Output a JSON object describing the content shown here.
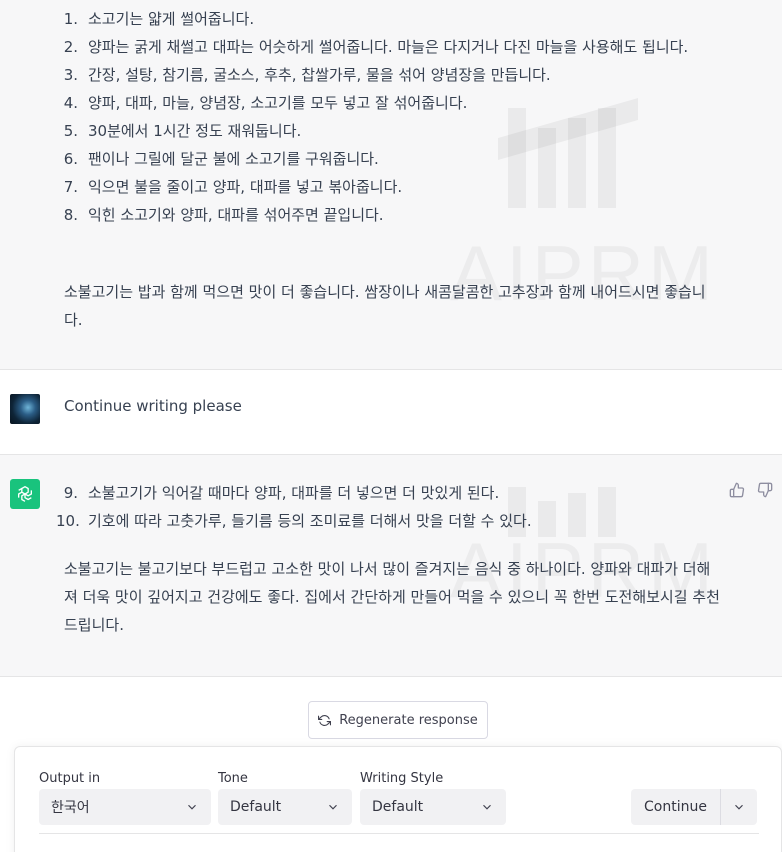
{
  "watermark": {
    "text": "AIPRM"
  },
  "response_1": {
    "steps": [
      {
        "num": "1.",
        "text": "소고기는 얇게 썰어줍니다."
      },
      {
        "num": "2.",
        "text": "양파는 굵게 채썰고 대파는 어슷하게 썰어줍니다. 마늘은 다지거나 다진 마늘을 사용해도 됩니다."
      },
      {
        "num": "3.",
        "text": "간장, 설탕, 참기름, 굴소스, 후추, 찹쌀가루, 물을 섞어 양념장을 만듭니다."
      },
      {
        "num": "4.",
        "text": "양파, 대파, 마늘, 양념장, 소고기를 모두 넣고 잘 섞어줍니다."
      },
      {
        "num": "5.",
        "text": "30분에서 1시간 정도 재워둡니다."
      },
      {
        "num": "6.",
        "text": "팬이나 그릴에 달군 불에 소고기를 구워줍니다."
      },
      {
        "num": "7.",
        "text": "익으면 불을 줄이고 양파, 대파를 넣고 볶아줍니다."
      },
      {
        "num": "8.",
        "text": "익힌 소고기와 양파, 대파를 섞어주면 끝입니다."
      }
    ],
    "closing": "소불고기는 밥과 함께 먹으면 맛이 더 좋습니다. 쌈장이나 새콤달콤한 고추장과 함께 내어드시면 좋습니다."
  },
  "user_message": {
    "text": "Continue writing please"
  },
  "response_2": {
    "steps": [
      {
        "num": "9.",
        "text": "소불고기가 익어갈 때마다 양파, 대파를 더 넣으면 더 맛있게 된다."
      },
      {
        "num": "10.",
        "text": "기호에 따라 고춧가루, 들기름 등의 조미료를 더해서 맛을 더할 수 있다."
      }
    ],
    "closing": "소불고기는 불고기보다 부드럽고 고소한 맛이 나서 많이 즐겨지는 음식 중 하나이다. 양파와 대파가 더해져 더욱 맛이 깊어지고 건강에도 좋다. 집에서 간단하게 만들어 먹을 수 있으니 꼭 한번 도전해보시길 추천드립니다."
  },
  "regenerate": {
    "label": "Regenerate response",
    "icon": "refresh-icon"
  },
  "prompt_panel": {
    "output": {
      "label": "Output in",
      "value": "한국어"
    },
    "tone": {
      "label": "Tone",
      "value": "Default"
    },
    "style": {
      "label": "Writing Style",
      "value": "Default"
    },
    "continue_label": "Continue"
  },
  "colors": {
    "bot_avatar": "#19c37d",
    "panel_bg": "#f7f7f8",
    "select_bg": "#f1f1f3"
  }
}
